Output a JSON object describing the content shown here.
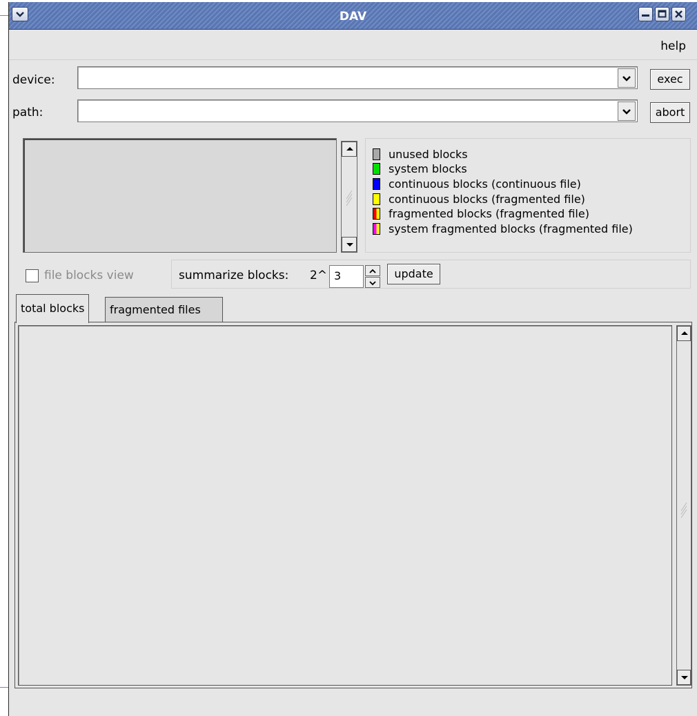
{
  "window": {
    "title": "DAV"
  },
  "menu": {
    "help": "help"
  },
  "device": {
    "label": "device:",
    "value": "",
    "button": "exec"
  },
  "path": {
    "label": "path:",
    "value": "",
    "button": "abort"
  },
  "legend": {
    "items": [
      {
        "label": "unused blocks",
        "colors": [
          "#a8a8a8"
        ]
      },
      {
        "label": "system blocks",
        "colors": [
          "#00e000"
        ]
      },
      {
        "label": "continuous blocks (continuous file)",
        "colors": [
          "#0000ff"
        ]
      },
      {
        "label": "continuous blocks (fragmented file)",
        "colors": [
          "#ffff00"
        ]
      },
      {
        "label": "fragmented blocks (fragmented file)",
        "colors": [
          "#ff0000",
          "#ffff00"
        ]
      },
      {
        "label": "system fragmented blocks (fragmented file)",
        "colors": [
          "#ff00ff",
          "#ffff00"
        ]
      }
    ]
  },
  "options": {
    "file_blocks_view": "file blocks view",
    "file_blocks_checked": false,
    "summarize_label": "summarize blocks:",
    "summarize_prefix": "2^",
    "summarize_value": "3",
    "update": "update"
  },
  "tabs": [
    {
      "label": "total blocks",
      "active": true
    },
    {
      "label": "fragmented files",
      "active": false
    }
  ]
}
